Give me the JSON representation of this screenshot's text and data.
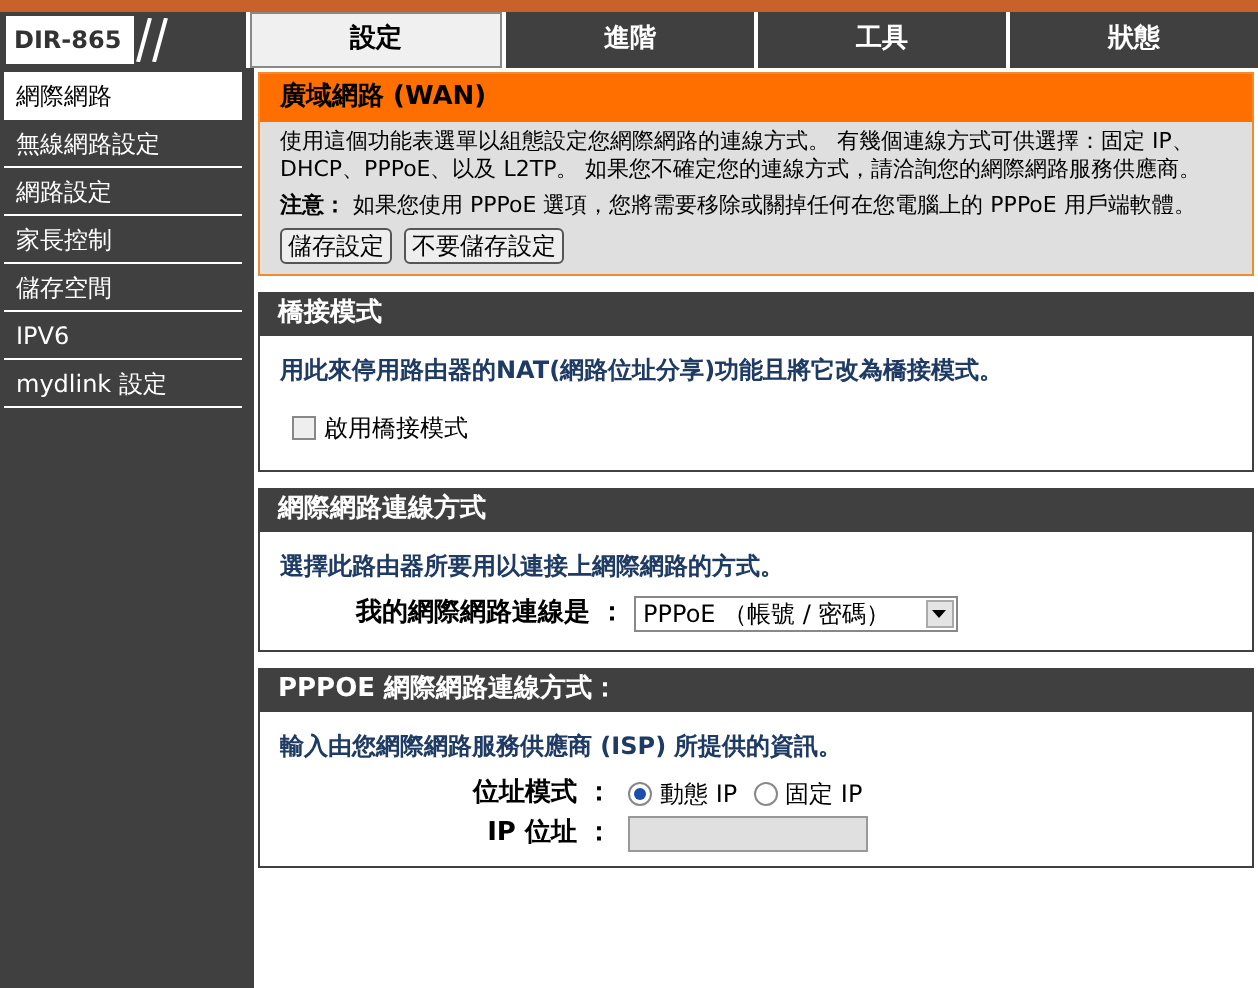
{
  "logo": "DIR-865",
  "tabs": [
    {
      "label": "設定",
      "selected": true
    },
    {
      "label": "進階",
      "selected": false
    },
    {
      "label": "工具",
      "selected": false
    },
    {
      "label": "狀態",
      "selected": false
    }
  ],
  "sidebar": {
    "items": [
      {
        "label": "網際網路",
        "selected": true
      },
      {
        "label": "無線網路設定",
        "selected": false
      },
      {
        "label": "網路設定",
        "selected": false
      },
      {
        "label": "家長控制",
        "selected": false
      },
      {
        "label": "儲存空間",
        "selected": false
      },
      {
        "label": "IPV6",
        "selected": false
      },
      {
        "label": "mydlink 設定",
        "selected": false
      }
    ]
  },
  "wan": {
    "title": "廣域網路 (WAN)",
    "description": "使用這個功能表選單以組態設定您網際網路的連線方式。 有幾個連線方式可供選擇：固定 IP、DHCP、PPPoE、以及 L2TP。 如果您不確定您的連線方式，請洽詢您的網際網路服務供應商。",
    "note": "**注意：** 如果您使用 PPPoE 選項，您將需要移除或關掉任何在您電腦上的 PPPoE 用戶端軟體。",
    "buttons": [
      "儲存設定",
      "不要儲存設定"
    ]
  },
  "sections": [
    {
      "kind": "bridge",
      "title": "橋接模式",
      "intro": "用此來停用路由器的NAT(網路位址分享)功能且將它改為橋接模式。",
      "checkbox": {
        "label": "啟用橋接模式",
        "checked": false
      }
    },
    {
      "kind": "connection",
      "title": "網際網路連線方式",
      "intro": "選擇此路由器所要用以連接上網際網路的方式。",
      "select": {
        "label": "我的網際網路連線是 ：",
        "value": "PPPoE （帳號 / 密碼）"
      }
    },
    {
      "kind": "pppoe",
      "title": "PPPOE 網際網路連線方式：",
      "intro": "輸入由您網際網路服務供應商 (ISP) 所提供的資訊。",
      "fields": [
        {
          "kind": "radio",
          "label": "位址模式 ：",
          "options": [
            {
              "label": "動態 IP",
              "selected": true
            },
            {
              "label": "固定 IP",
              "selected": false
            }
          ]
        },
        {
          "kind": "text",
          "label": "IP 位址 ：",
          "disabled": true
        }
      ]
    }
  ]
}
